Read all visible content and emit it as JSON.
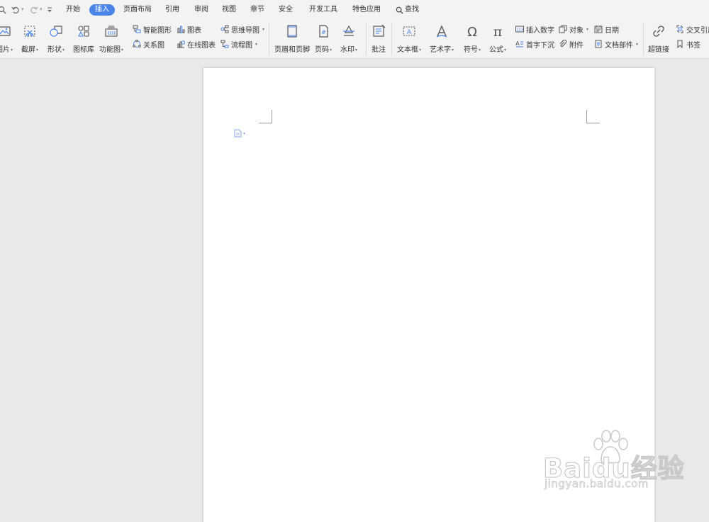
{
  "quick_access": {
    "icons": [
      "print-preview-icon",
      "undo-icon",
      "redo-icon",
      "customize-icon"
    ]
  },
  "menu": {
    "tabs": [
      "开始",
      "插入",
      "页面布局",
      "引用",
      "审阅",
      "视图",
      "章节",
      "安全",
      "开发工具",
      "特色应用"
    ],
    "active": "插入",
    "search_label": "查找"
  },
  "ribbon": {
    "picture": "图片",
    "screenshot": "截屏",
    "shape": "形状",
    "icon_library": "图标库",
    "function_chart": "功能图",
    "smart_graphic": "智能图形",
    "chart": "图表",
    "mind_map": "思维导图",
    "relation_chart": "关系图",
    "online_chart": "在线图表",
    "flowchart": "流程图",
    "header_footer": "页眉和页脚",
    "page_number": "页码",
    "page_number_glyph": "#",
    "watermark": "水印",
    "comment": "批注",
    "textbox": "文本框",
    "wordart": "艺术字",
    "symbol": "符号",
    "symbol_glyph": "Ω",
    "formula": "公式",
    "formula_glyph": "π",
    "insert_number": "插入数字",
    "insert_number_glyph": "123",
    "drop_cap": "首字下沉",
    "object": "对象",
    "attachment": "附件",
    "date": "日期",
    "doc_parts": "文档部件",
    "hyperlink": "超链接",
    "cross_reference": "交叉引用",
    "bookmark": "书签"
  },
  "watermark": {
    "brand": "Bai",
    "brand_rest": "du",
    "brand_cn": "经验",
    "url": "jingyan.baidu.com"
  },
  "colors": {
    "accent": "#4a86e8",
    "ribbon_bg": "#f3f3f3",
    "workspace_bg": "#e9e9e9",
    "page_bg": "#ffffff"
  }
}
